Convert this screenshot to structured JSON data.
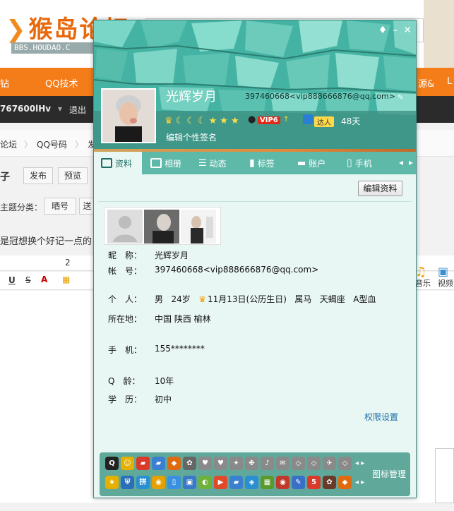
{
  "background": {
    "logo_text": "猴岛论坛",
    "logo_url": "BBS.HOUDAO.C",
    "nav_items": [
      "钻",
      "QQ技术",
      "源&",
      "L"
    ],
    "username": "767600lHv",
    "logout": "退出",
    "breadcrumbs": [
      "论坛",
      "QQ号码",
      "发"
    ],
    "title_suffix": "子",
    "publish_button": "发布",
    "preview_button": "预览",
    "topic_category_label": "主题分类：",
    "category_options": [
      "晒号",
      "送"
    ],
    "subject_text": "是冠想换个好记一点的",
    "font_size": "2",
    "toolbar_labels": [
      "音乐",
      "视频"
    ]
  },
  "profile": {
    "nickname": "光辉岁月",
    "account_header": "397460668<vip888666876@qq.com>",
    "vip_label": "VIP6",
    "daren_label": "达人",
    "active_days": "48天",
    "signature_placeholder": "编辑个性签名",
    "tabs": [
      {
        "label": "资料",
        "icon": "profile-card-icon"
      },
      {
        "label": "相册",
        "icon": "album-icon"
      },
      {
        "label": "动态",
        "icon": "feed-icon"
      },
      {
        "label": "标签",
        "icon": "bookmark-icon"
      },
      {
        "label": "账户",
        "icon": "wallet-icon"
      },
      {
        "label": "手机",
        "icon": "phone-icon"
      }
    ],
    "edit_button": "编辑资料",
    "fields": {
      "nickname_label": "昵　称：",
      "nickname_value": "光辉岁月",
      "account_label": "帐　号：",
      "account_value": "397460668<vip888666876@qq.com>",
      "personal_label": "个　人：",
      "gender": "男",
      "age": "24岁",
      "birthday": "11月13日(公历生日)",
      "zodiac_animal": "属马",
      "constellation": "天蝎座",
      "blood_type": "A型血",
      "location_label": "所在地：",
      "location_value": "中国 陕西 榆林",
      "phone_label": "手　机：",
      "phone_value": "155********",
      "qq_age_label": "Q　龄：",
      "qq_age_value": "10年",
      "education_label": "学　历：",
      "education_value": "初中"
    },
    "permission_link": "权限设置",
    "icon_manage": "图标管理"
  },
  "colors": {
    "accent_teal": "#45b3a3",
    "tab_bar": "#5fb9a9",
    "panel_bg": "#e9f7f4",
    "link_blue": "#1a6fa8",
    "nav_orange": "#f47c19"
  }
}
